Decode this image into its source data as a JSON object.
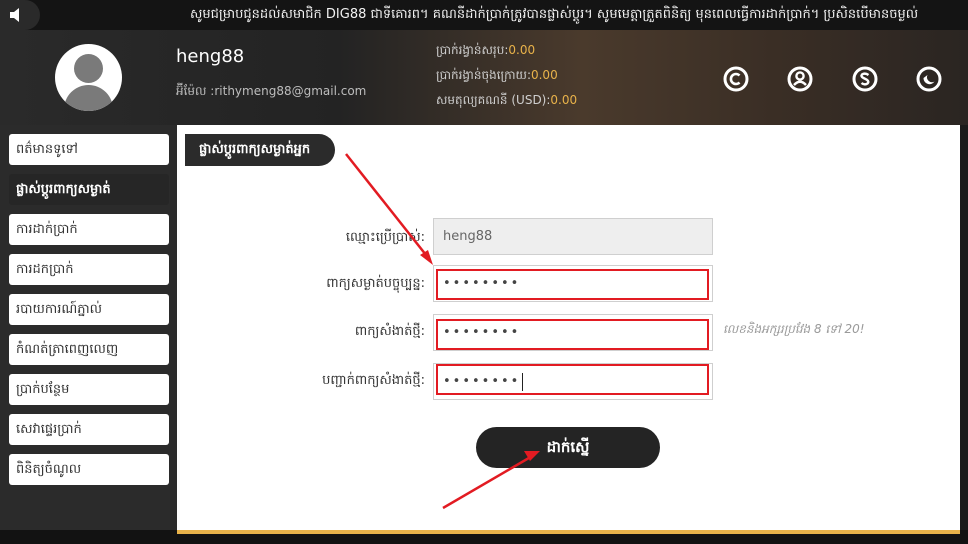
{
  "marquee": {
    "text": "សូមជម្រាបជូនដល់សមាជិក DIG88 ជាទីគោរព។ គណនីដាក់ប្រាក់ត្រូវបានផ្លាស់ប្តូរ។ សូមមេត្តាត្រួតពិនិត្យ មុនពេលធ្វើការដាក់ប្រាក់។ ប្រសិនបើមានចម្ងល់"
  },
  "header": {
    "username": "heng88",
    "email_label": "អ៊ីម៉ែល",
    "email_value": ":rithymeng88@gmail.com",
    "balances": [
      {
        "label": "ប្រាក់រង្វាន់សរុប:",
        "value": "0.00"
      },
      {
        "label": "ប្រាក់រង្វាន់ចុងក្រោយ:",
        "value": "0.00"
      },
      {
        "label": "សមតុល្យគណនី (USD):",
        "value": "0.00"
      }
    ],
    "icons": [
      "copyright-circle-icon",
      "user-circle-icon",
      "dollar-circle-icon",
      "moon-circle-icon"
    ]
  },
  "sidebar": {
    "items": [
      {
        "label": "ពត៌មានទូទៅ",
        "active": false
      },
      {
        "label": "ផ្លាស់ប្តូរពាក្យសម្ងាត់",
        "active": true
      },
      {
        "label": "ការដាក់ប្រាក់",
        "active": false
      },
      {
        "label": "ការដកប្រាក់",
        "active": false
      },
      {
        "label": "របាយការណ៍ភ្នាល់",
        "active": false
      },
      {
        "label": "កំណត់ត្រាពេញលេញ",
        "active": false
      },
      {
        "label": "ប្រាក់បន្ថែម",
        "active": false
      },
      {
        "label": "សេវាផ្ទេរប្រាក់",
        "active": false
      },
      {
        "label": "ពិនិត្យចំណូល",
        "active": false
      }
    ]
  },
  "main": {
    "page_title": "ផ្លាស់ប្តូរពាក្យសម្ងាត់អ្នក",
    "form": {
      "username_label": "ឈ្មោះប្រើប្រាស់:",
      "username_value": "heng88",
      "current_password_label": "ពាក្យសម្ងាត់បច្ចុប្បន្ន:",
      "current_password_value": "••••••••",
      "new_password_label": "ពាក្យសំងាត់ថ្មី:",
      "new_password_value": "••••••••",
      "new_password_hint": "លេខនិងអក្សរប្រវែង 8 ទៅ 20!",
      "confirm_password_label": "បញ្ជាក់ពាក្យសំងាត់ថ្មី:",
      "confirm_password_value": "••••••••",
      "submit_label": "ដាក់ស្នើ"
    }
  },
  "colors": {
    "accent_gold": "#e8b24a",
    "highlight_red": "#e21b22",
    "dark_bg": "#1b1b1b"
  }
}
